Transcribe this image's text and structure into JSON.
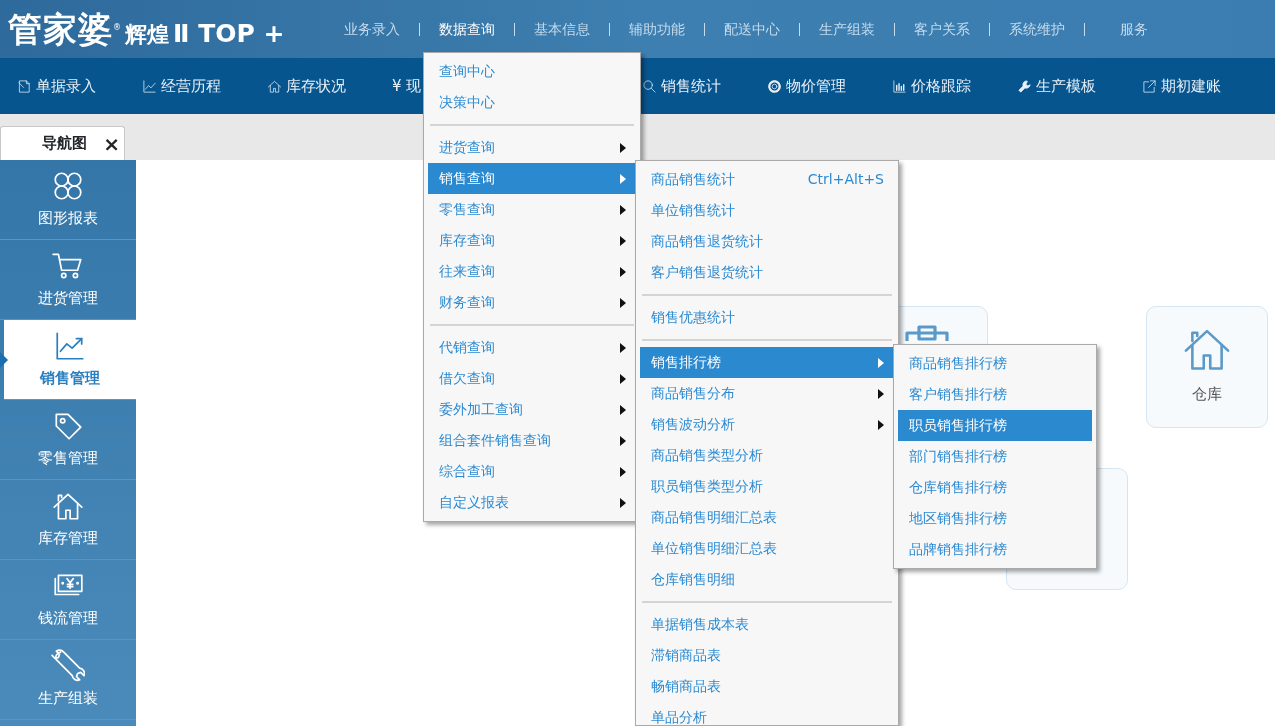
{
  "logo": {
    "name": "管家婆",
    "mark": "®",
    "series": "辉煌",
    "edition": "Ⅱ TOP +"
  },
  "main_menu": [
    {
      "label": "业务录入",
      "selected": false
    },
    {
      "label": "数据查询",
      "selected": true,
      "submenu": [
        [
          {
            "label": "查询中心",
            "selected": false,
            "arrow": false
          },
          {
            "label": "决策中心",
            "selected": false,
            "arrow": false
          }
        ],
        [
          {
            "label": "进货查询",
            "selected": false,
            "arrow": true
          },
          {
            "label": "销售查询",
            "selected": true,
            "arrow": true,
            "submenu": [
              [
                {
                  "label": "商品销售统计",
                  "shortcut": "Ctrl+Alt+S",
                  "selected": false,
                  "arrow": false
                },
                {
                  "label": "单位销售统计",
                  "selected": false,
                  "arrow": false
                },
                {
                  "label": "商品销售退货统计",
                  "selected": false,
                  "arrow": false
                },
                {
                  "label": "客户销售退货统计",
                  "selected": false,
                  "arrow": false
                }
              ],
              [
                {
                  "label": "销售优惠统计",
                  "selected": false,
                  "arrow": false
                }
              ],
              [
                {
                  "label": "销售排行榜",
                  "selected": true,
                  "arrow": true,
                  "submenu": [
                    [
                      {
                        "label": "商品销售排行榜",
                        "selected": false,
                        "arrow": false
                      },
                      {
                        "label": "客户销售排行榜",
                        "selected": false,
                        "arrow": false
                      },
                      {
                        "label": "职员销售排行榜",
                        "selected": true,
                        "arrow": false
                      },
                      {
                        "label": "部门销售排行榜",
                        "selected": false,
                        "arrow": false
                      },
                      {
                        "label": "仓库销售排行榜",
                        "selected": false,
                        "arrow": false
                      },
                      {
                        "label": "地区销售排行榜",
                        "selected": false,
                        "arrow": false
                      },
                      {
                        "label": "品牌销售排行榜",
                        "selected": false,
                        "arrow": false
                      }
                    ]
                  ]
                },
                {
                  "label": "商品销售分布",
                  "selected": false,
                  "arrow": true
                },
                {
                  "label": "销售波动分析",
                  "selected": false,
                  "arrow": true
                },
                {
                  "label": "商品销售类型分析",
                  "selected": false,
                  "arrow": false
                },
                {
                  "label": "职员销售类型分析",
                  "selected": false,
                  "arrow": false
                },
                {
                  "label": "商品销售明细汇总表",
                  "selected": false,
                  "arrow": false
                },
                {
                  "label": "单位销售明细汇总表",
                  "selected": false,
                  "arrow": false
                },
                {
                  "label": "仓库销售明细",
                  "selected": false,
                  "arrow": false
                }
              ],
              [
                {
                  "label": "单据销售成本表",
                  "selected": false,
                  "arrow": false
                },
                {
                  "label": "滞销商品表",
                  "selected": false,
                  "arrow": false
                },
                {
                  "label": "畅销商品表",
                  "selected": false,
                  "arrow": false
                },
                {
                  "label": "单品分析",
                  "selected": false,
                  "arrow": false
                }
              ]
            ]
          },
          {
            "label": "零售查询",
            "selected": false,
            "arrow": true
          },
          {
            "label": "库存查询",
            "selected": false,
            "arrow": true
          },
          {
            "label": "往来查询",
            "selected": false,
            "arrow": true
          },
          {
            "label": "财务查询",
            "selected": false,
            "arrow": true
          }
        ],
        [
          {
            "label": "代销查询",
            "selected": false,
            "arrow": true
          },
          {
            "label": "借欠查询",
            "selected": false,
            "arrow": true
          },
          {
            "label": "委外加工查询",
            "selected": false,
            "arrow": true
          },
          {
            "label": "组合套件销售查询",
            "selected": false,
            "arrow": true
          },
          {
            "label": "综合查询",
            "selected": false,
            "arrow": true
          },
          {
            "label": "自定义报表",
            "selected": false,
            "arrow": true
          }
        ]
      ]
    },
    {
      "label": "基本信息",
      "selected": false
    },
    {
      "label": "辅助功能",
      "selected": false
    },
    {
      "label": "配送中心",
      "selected": false
    },
    {
      "label": "生产组装",
      "selected": false
    },
    {
      "label": "客户关系",
      "selected": false
    },
    {
      "label": "系统维护",
      "selected": false
    },
    {
      "label": "服务",
      "selected": false
    }
  ],
  "toolbar": [
    {
      "label": "单据录入",
      "kind": "edit"
    },
    {
      "label": "经营历程",
      "kind": "chart"
    },
    {
      "label": "库存状况",
      "kind": "house"
    },
    {
      "label": "¥ 现",
      "kind": "text"
    },
    {
      "label": "销售统计",
      "kind": "search"
    },
    {
      "label": "物价管理",
      "kind": "gear"
    },
    {
      "label": "价格跟踪",
      "kind": "bars"
    },
    {
      "label": "生产模板",
      "kind": "wrench"
    },
    {
      "label": "期初建账",
      "kind": "export"
    }
  ],
  "tabs": [
    {
      "label": "导航图",
      "selected": true,
      "close": "×"
    }
  ],
  "sidebar": [
    {
      "label": "图形报表",
      "selected": false,
      "kind": "clover"
    },
    {
      "label": "进货管理",
      "selected": false,
      "kind": "cart"
    },
    {
      "label": "销售管理",
      "selected": true,
      "kind": "trend"
    },
    {
      "label": "零售管理",
      "selected": false,
      "kind": "tag"
    },
    {
      "label": "库存管理",
      "selected": false,
      "kind": "house"
    },
    {
      "label": "钱流管理",
      "selected": false,
      "kind": "money"
    },
    {
      "label": "生产组装",
      "selected": false,
      "kind": "wrench"
    }
  ],
  "nav_cards": [
    {
      "kind": "clipboard"
    },
    {
      "kind": "house",
      "label": "仓库"
    },
    {
      "kind": "blank"
    }
  ]
}
